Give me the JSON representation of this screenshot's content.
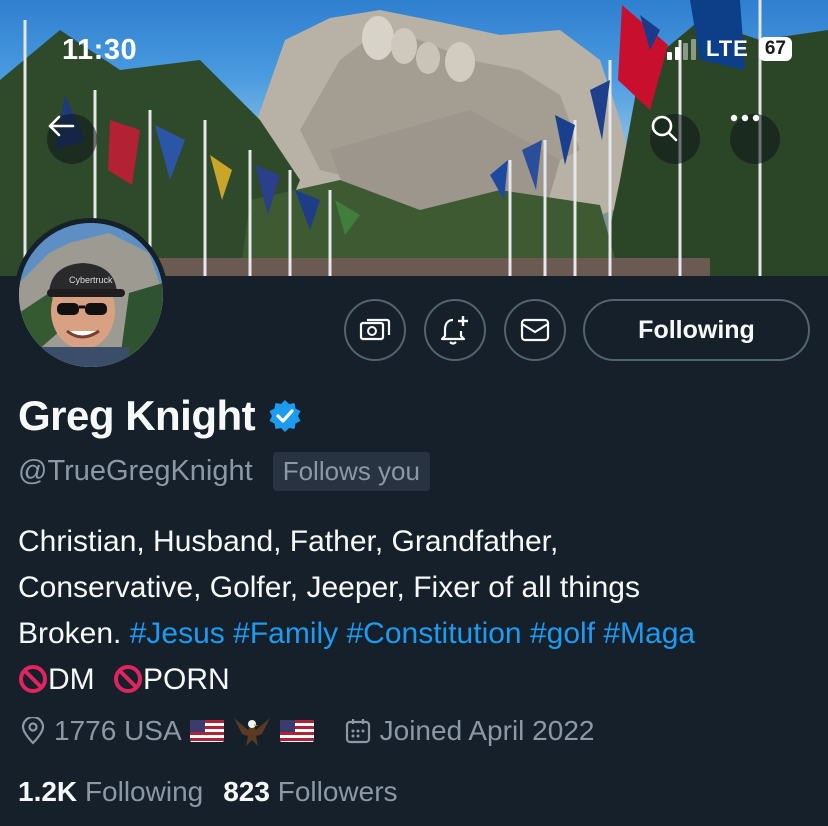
{
  "status_bar": {
    "time": "11:30",
    "network": "LTE",
    "battery": "67"
  },
  "header": {
    "back_icon": "arrow-left-icon",
    "search_icon": "search-icon",
    "more_icon": "ellipsis-icon"
  },
  "actions": {
    "tip_icon": "money-tip-icon",
    "notify_icon": "bell-plus-icon",
    "message_icon": "envelope-icon",
    "following_label": "Following"
  },
  "profile": {
    "name": "Greg Knight",
    "verified_icon": "verified-badge-icon",
    "handle": "@TrueGregKnight",
    "follows_you": "Follows you",
    "bio_line1": "Christian, Husband, Father, Grandfather,",
    "bio_line2": "Conservative, Golfer, Jeeper, Fixer of all things",
    "bio_line3_text": "Broken.",
    "hashtags": [
      "#Jesus",
      "#Family",
      "#Constitution",
      "#golf",
      "#Maga"
    ],
    "bio_line4_dm": "DM",
    "bio_line4_porn": "PORN",
    "location": "1776 USA",
    "joined": "Joined April 2022"
  },
  "stats": {
    "following_count": "1.2K",
    "following_label": "Following",
    "followers_count": "823",
    "followers_label": "Followers"
  },
  "colors": {
    "background": "#15202b",
    "accent": "#1d9bf0",
    "muted": "#8b98a5",
    "border": "#536471"
  }
}
